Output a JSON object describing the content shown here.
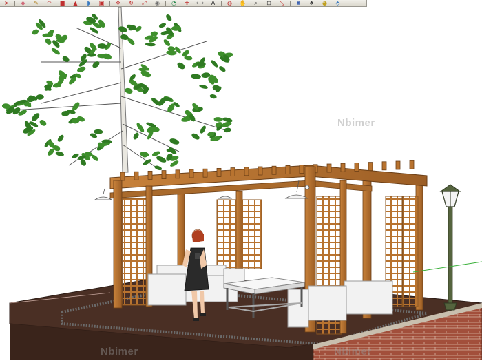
{
  "toolbar": {
    "tools": [
      {
        "icon": "select-arrow-icon",
        "glyph": "➤",
        "color": "#c03030"
      },
      {
        "icon": "sep"
      },
      {
        "icon": "eraser-icon",
        "glyph": "◆",
        "color": "#d06a7a"
      },
      {
        "icon": "pencil-icon",
        "glyph": "✎",
        "color": "#b08020"
      },
      {
        "icon": "arc-icon",
        "glyph": "◠",
        "color": "#c03030"
      },
      {
        "icon": "shape-icon",
        "glyph": "■",
        "color": "#c03030"
      },
      {
        "icon": "push-pull-icon",
        "glyph": "▲",
        "color": "#c03030"
      },
      {
        "icon": "follow-me-icon",
        "glyph": "◗",
        "color": "#3a7ac0"
      },
      {
        "icon": "offset-icon",
        "glyph": "▣",
        "color": "#c03030"
      },
      {
        "icon": "sep"
      },
      {
        "icon": "move-icon",
        "glyph": "✥",
        "color": "#c03030"
      },
      {
        "icon": "rotate-icon",
        "glyph": "↻",
        "color": "#c03030"
      },
      {
        "icon": "scale-icon",
        "glyph": "⤢",
        "color": "#c03030"
      },
      {
        "icon": "tape-measure-icon",
        "glyph": "◉",
        "color": "#707070"
      },
      {
        "icon": "sep"
      },
      {
        "icon": "protractor-icon",
        "glyph": "◔",
        "color": "#2a8a50"
      },
      {
        "icon": "axes-icon",
        "glyph": "✚",
        "color": "#c03030"
      },
      {
        "icon": "dimension-icon",
        "glyph": "⟷",
        "color": "#707070"
      },
      {
        "icon": "text-icon",
        "glyph": "A",
        "color": "#404040"
      },
      {
        "icon": "sep"
      },
      {
        "icon": "orbit-icon",
        "glyph": "◍",
        "color": "#c03030"
      },
      {
        "icon": "pan-icon",
        "glyph": "✋",
        "color": "#b08020"
      },
      {
        "icon": "zoom-icon",
        "glyph": "⌕",
        "color": "#404040"
      },
      {
        "icon": "zoom-window-icon",
        "glyph": "⊡",
        "color": "#404040"
      },
      {
        "icon": "zoom-extents-icon",
        "glyph": "⤡",
        "color": "#c03030"
      },
      {
        "icon": "sep"
      },
      {
        "icon": "walk-icon",
        "glyph": "♜",
        "color": "#3a60b0"
      },
      {
        "icon": "position-camera-icon",
        "glyph": "♠",
        "color": "#404040"
      },
      {
        "icon": "look-around-icon",
        "glyph": "◕",
        "color": "#c0a020"
      },
      {
        "icon": "section-plane-icon",
        "glyph": "⬘",
        "color": "#3a7ac0"
      }
    ]
  },
  "watermarks": [
    "Nbimer",
    "Nbimer",
    "Nbimer"
  ],
  "colors": {
    "timber": "#b8732f",
    "timber_dark": "#7a4a1c",
    "deck": "#4a2f24",
    "brick": "#a0503c",
    "leaf": "#3e8f2c",
    "dress": "#2a2a2a",
    "lamp": "#55643e"
  }
}
